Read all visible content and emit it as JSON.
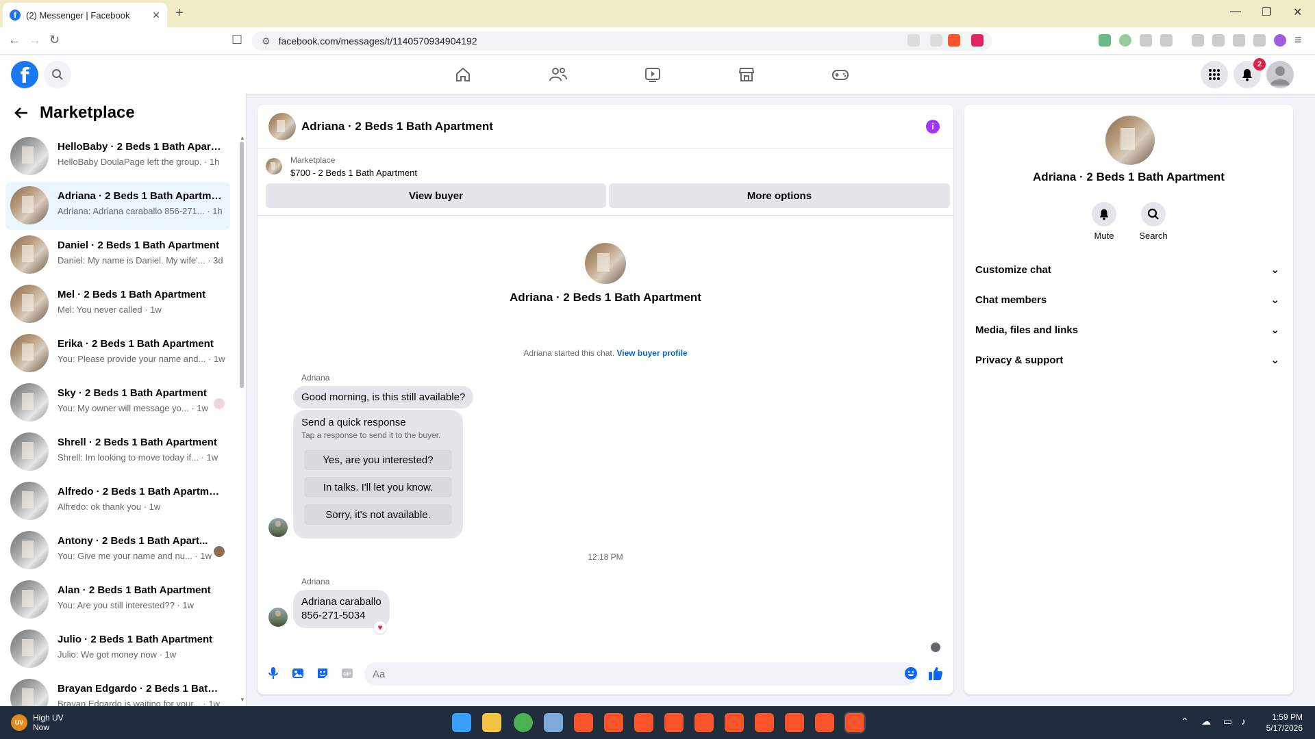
{
  "browser": {
    "tab_title": "(2) Messenger | Facebook",
    "url": "facebook.com/messages/t/1140570934904192"
  },
  "fb": {
    "notification_count": "2"
  },
  "left": {
    "title": "Marketplace",
    "conversations": [
      {
        "name": "HelloBaby · 2 Beds 1 Bath Apart...",
        "preview": "HelloBaby DoulaPage left the group. · 1h"
      },
      {
        "name": "Adriana · 2 Beds 1 Bath Apartment",
        "preview": "Adriana: Adriana caraballo 856-271... · 1h"
      },
      {
        "name": "Daniel · 2 Beds 1 Bath Apartment",
        "preview": "Daniel: My name is Daniel. My wife'... · 3d"
      },
      {
        "name": "Mel · 2 Beds 1 Bath Apartment",
        "preview": "Mel: You never called · 1w"
      },
      {
        "name": "Erika · 2 Beds 1 Bath Apartment",
        "preview": "You: Please provide your name and... · 1w"
      },
      {
        "name": "Sky · 2 Beds 1 Bath Apartment",
        "preview": "You: My owner will message yo... · 1w"
      },
      {
        "name": "Shrell · 2 Beds 1 Bath Apartment",
        "preview": "Shrell: Im looking to move today if... · 1w"
      },
      {
        "name": "Alfredo · 2 Beds 1 Bath Apartment",
        "preview": "Alfredo: ok thank you · 1w"
      },
      {
        "name": "Antony · 2 Beds 1 Bath Apart...",
        "preview": "You: Give me your name and nu... · 1w"
      },
      {
        "name": "Alan · 2 Beds 1 Bath Apartment",
        "preview": "You: Are you still interested?? · 1w"
      },
      {
        "name": "Julio · 2 Beds 1 Bath Apartment",
        "preview": "Julio: We got money now · 1w"
      },
      {
        "name": "Brayan Edgardo · 2 Beds 1 Bath ...",
        "preview": "Brayan Edgardo is waiting for your... · 1w"
      }
    ]
  },
  "chat": {
    "title": "Adriana · 2 Beds 1 Bath Apartment",
    "marketplace_label": "Marketplace",
    "listing": "$700 - 2 Beds 1 Bath Apartment",
    "view_buyer": "View buyer",
    "more_options": "More options",
    "center_name": "Adriana · 2 Beds 1 Bath Apartment",
    "started_text": "Adriana started this chat.",
    "view_buyer_profile": "View buyer profile",
    "sender1": "Adriana",
    "msg1": "Good morning, is this still available?",
    "quick_title": "Send a quick response",
    "quick_sub": "Tap a response to send it to the buyer.",
    "quick_replies": [
      "Yes, are you interested?",
      "In talks. I'll let you know.",
      "Sorry, it's not available."
    ],
    "timestamp": "12:18 PM",
    "sender2": "Adriana",
    "msg2_line1": "Adriana caraballo",
    "msg2_line2": "856-271-5034",
    "composer_placeholder": "Aa"
  },
  "right": {
    "name": "Adriana · 2 Beds 1 Bath Apartment",
    "mute": "Mute",
    "search": "Search",
    "sections": [
      "Customize chat",
      "Chat members",
      "Media, files and links",
      "Privacy & support"
    ]
  },
  "taskbar": {
    "weather_title": "High UV",
    "weather_sub": "Now",
    "weather_badge": "UV",
    "time": "1:59 PM",
    "date": "5/17/2026"
  }
}
